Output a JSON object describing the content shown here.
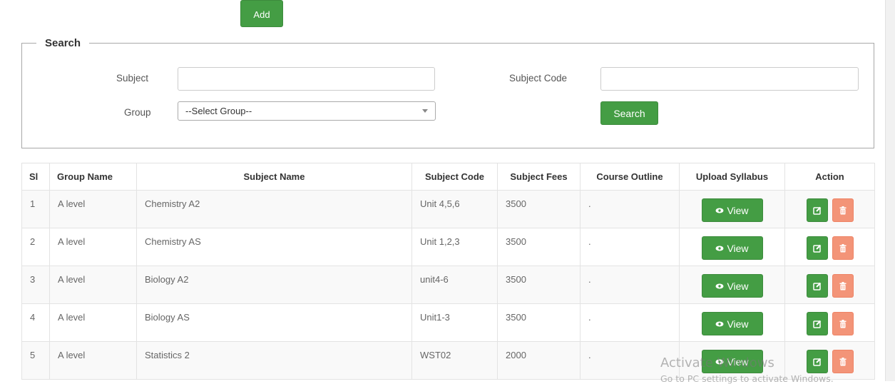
{
  "toolbar": {
    "add_label": "Add"
  },
  "search": {
    "legend": "Search",
    "subject_label": "Subject",
    "subject_value": "",
    "subject_code_label": "Subject Code",
    "subject_code_value": "",
    "group_label": "Group",
    "group_selected": "--Select Group--",
    "search_label": "Search"
  },
  "table": {
    "headers": [
      "Sl",
      "Group Name",
      "Subject Name",
      "Subject Code",
      "Subject Fees",
      "Course Outline",
      "Upload Syllabus",
      "Action"
    ],
    "view_label": "View",
    "rows": [
      {
        "sl": "1",
        "group": "A level",
        "subject": "Chemistry A2",
        "code": "Unit 4,5,6",
        "fees": "3500",
        "outline": "."
      },
      {
        "sl": "2",
        "group": "A level",
        "subject": "Chemistry AS",
        "code": "Unit 1,2,3",
        "fees": "3500",
        "outline": "."
      },
      {
        "sl": "3",
        "group": "A level",
        "subject": "Biology A2",
        "code": "unit4-6",
        "fees": "3500",
        "outline": "."
      },
      {
        "sl": "4",
        "group": "A level",
        "subject": "Biology AS",
        "code": "Unit1-3",
        "fees": "3500",
        "outline": "."
      },
      {
        "sl": "5",
        "group": "A level",
        "subject": "Statistics 2",
        "code": "WST02",
        "fees": "2000",
        "outline": "."
      }
    ]
  },
  "icons": {
    "view": "eye-icon",
    "edit": "edit-icon",
    "delete": "trash-icon"
  },
  "colors": {
    "primary_green": "#449d44",
    "danger_salmon": "#f39478"
  },
  "watermark": {
    "line1": "Activate Windows",
    "line2": "Go to PC settings to activate Windows."
  }
}
